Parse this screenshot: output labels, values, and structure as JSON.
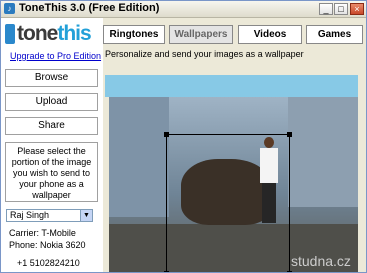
{
  "window": {
    "title": "ToneThis 3.0 (Free Edition)"
  },
  "logo": {
    "tone": "tone",
    "this": "this"
  },
  "sidebar": {
    "upgrade_link": "Upgrade to Pro Edition",
    "buttons": [
      "Browse",
      "Upload",
      "Share"
    ],
    "instructions": "Please select the portion of the image you wish to send to your phone as a wallpaper",
    "selected_contact": "Raj Singh",
    "carrier": "Carrier:  T-Mobile",
    "phone": "Phone:  Nokia 3620",
    "number": "+1 5102824210"
  },
  "tabs": [
    "Ringtones",
    "Wallpapers",
    "Videos",
    "Games"
  ],
  "main": {
    "hint": "Personalize and send your images as a wallpaper"
  },
  "watermark": "studna.cz"
}
